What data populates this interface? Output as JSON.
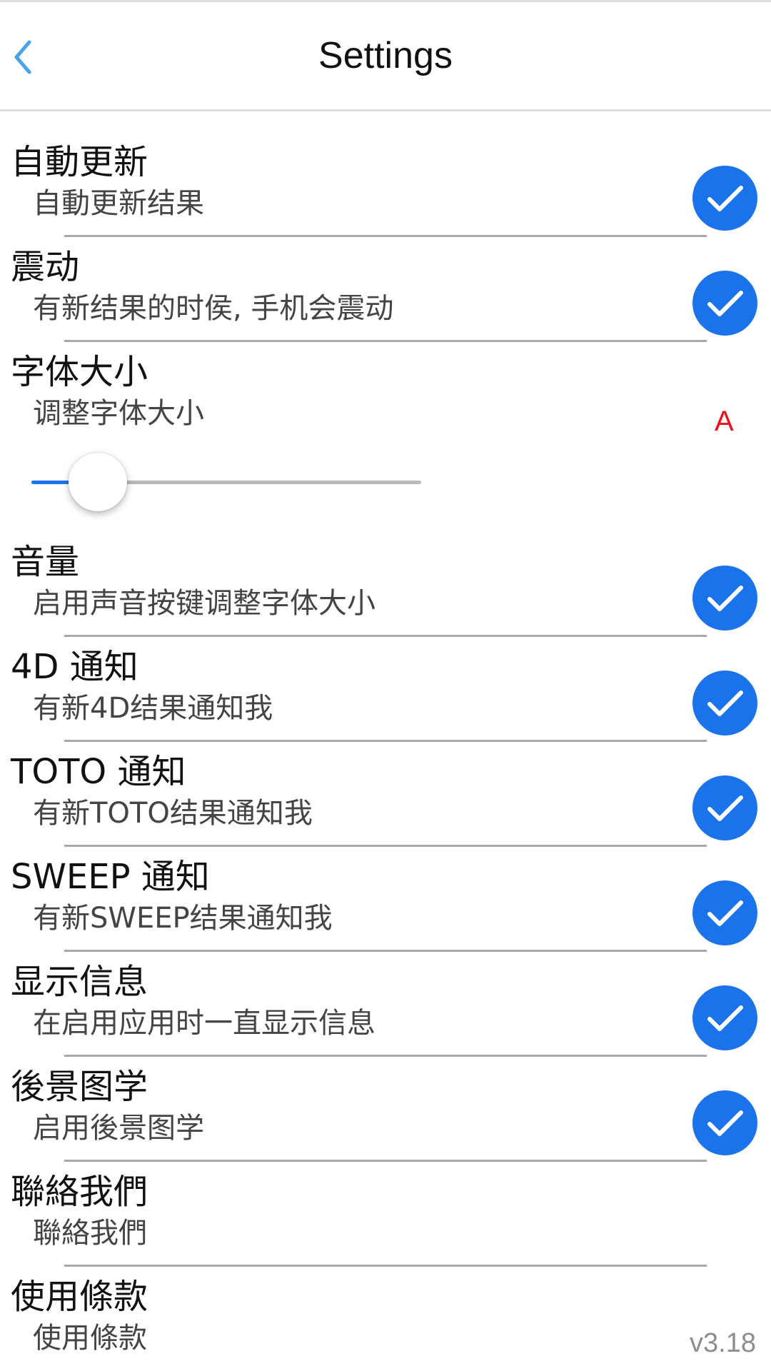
{
  "header": {
    "title": "Settings",
    "back_icon": "chevron-left-icon"
  },
  "colors": {
    "accent": "#1a73ea",
    "font_size_indicator": "#e8121c"
  },
  "settings": [
    {
      "title": "自動更新",
      "subtitle": "自動更新结果",
      "checked": true
    },
    {
      "title": "震动",
      "subtitle": "有新结果的时侯, 手机会震动",
      "checked": true
    },
    {
      "title": "字体大小",
      "subtitle": "调整字体大小",
      "indicator": "A",
      "slider_value": 0.17
    },
    {
      "title": "音量",
      "subtitle": "启用声音按键调整字体大小",
      "checked": true
    },
    {
      "title": "4D 通知",
      "subtitle": "有新4D结果通知我",
      "checked": true
    },
    {
      "title": "TOTO 通知",
      "subtitle": "有新TOTO结果通知我",
      "checked": true
    },
    {
      "title": "SWEEP 通知",
      "subtitle": "有新SWEEP结果通知我",
      "checked": true
    },
    {
      "title": "显示信息",
      "subtitle": "在启用应用时一直显示信息",
      "checked": true
    },
    {
      "title": "後景图学",
      "subtitle": "启用後景图学",
      "checked": true
    },
    {
      "title": "聯絡我們",
      "subtitle": "聯絡我們"
    },
    {
      "title": "使用條款",
      "subtitle": "使用條款"
    }
  ],
  "version": "v3.18"
}
